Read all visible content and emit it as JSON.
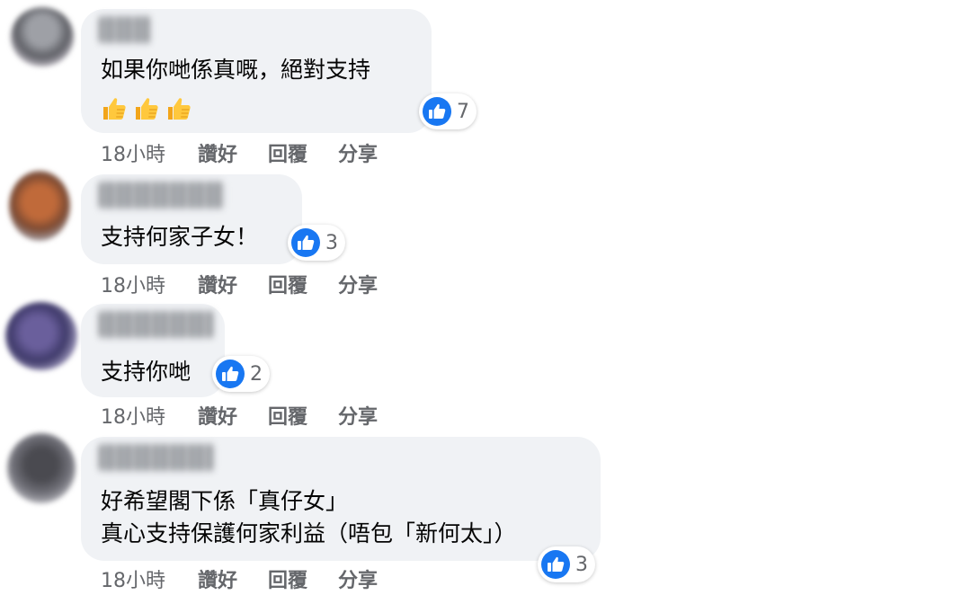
{
  "comments": [
    {
      "text": "如果你哋係真嘅，絕對支持",
      "emoji": [
        "thumbs-up-emoji",
        "thumbs-up-emoji",
        "thumbs-up-emoji"
      ],
      "reactions": {
        "icon": "like-icon",
        "count": "7"
      },
      "time": "18小時",
      "actions": {
        "like": "讚好",
        "reply": "回覆",
        "share": "分享"
      }
    },
    {
      "text": "支持何家子女！",
      "reactions": {
        "icon": "like-icon",
        "count": "3"
      },
      "time": "18小時",
      "actions": {
        "like": "讚好",
        "reply": "回覆",
        "share": "分享"
      }
    },
    {
      "text": "支持你哋",
      "reactions": {
        "icon": "like-icon",
        "count": "2"
      },
      "time": "18小時",
      "actions": {
        "like": "讚好",
        "reply": "回覆",
        "share": "分享"
      }
    },
    {
      "text_lines": [
        "好希望閣下係「真仔女」",
        "真心支持保護何家利益（唔包「新何太」）"
      ],
      "reactions": {
        "icon": "like-icon",
        "count": "3"
      },
      "time": "18小時",
      "actions": {
        "like": "讚好",
        "reply": "回覆",
        "share": "分享"
      }
    }
  ],
  "colors": {
    "bubble": "#f0f2f5",
    "like_blue": "#1877f2",
    "meta_text": "#65676b",
    "body_text": "#050505"
  }
}
